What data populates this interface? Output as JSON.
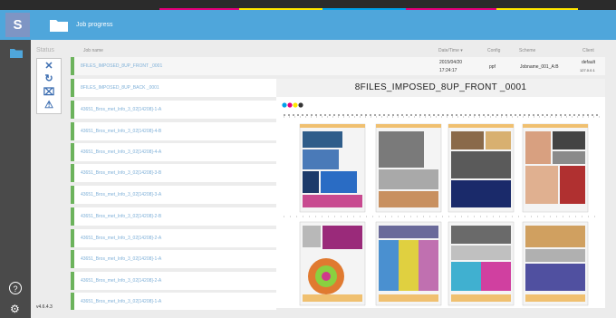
{
  "app": {
    "logo_letter": "S",
    "title": "Job progress"
  },
  "sidebar": {
    "folder_icon": "folder-icon",
    "help_icon": "help-icon",
    "settings_icon": "gear-icon"
  },
  "status_header": "Status",
  "actions": [
    {
      "name": "cancel-action",
      "icon": "close-icon",
      "glyph": "✕"
    },
    {
      "name": "refresh-action",
      "icon": "refresh-icon",
      "glyph": "↻"
    },
    {
      "name": "delete-action",
      "icon": "trash-icon",
      "glyph": "⌧"
    },
    {
      "name": "warning-action",
      "icon": "warning-icon",
      "glyph": "⚠"
    }
  ],
  "table": {
    "headers": {
      "job_name": "Job name",
      "datetime": "Date/Time ▾",
      "config": "Config",
      "scheme": "Scheme",
      "client": "Client"
    },
    "selected": {
      "job_name": "8FILES_IMPOSED_8UP_FRONT _0001",
      "date": "2015/04/20",
      "time": "17:24:17",
      "config": "ppf",
      "scheme": "Jobname_001_A:B",
      "client_name": "default",
      "client_ip": "127.0.0.1"
    },
    "rows": [
      "8FILES_IMPOSED_8UP_BACK _0001",
      "43651_Bros_met_Info_3_02[14208]-1-A",
      "43651_Bros_met_Info_3_02[14208]-4-B",
      "43651_Bros_met_Info_3_02[14208]-4-A",
      "43651_Bros_met_Info_3_02[14208]-3-B",
      "43651_Bros_met_Info_3_02[14208]-3-A",
      "43651_Bros_met_Info_3_02[14208]-2-B",
      "43651_Bros_met_Info_3_02[14208]-2-A",
      "43651_Bros_met_Info_3_02[14208]-1-A",
      "43651_Bros_met_Info_3_02[14208]-2-A",
      "43651_Bros_met_Info_3_02[14208]-1-A"
    ]
  },
  "preview": {
    "title": "8FILES_IMPOSED_8UP_FRONT _0001"
  },
  "version": "v4.6.4.3",
  "colors": {
    "header_blue": "#4fa6db",
    "sidebar_dark": "#4a4a4a",
    "logo_purple": "#7e95c4",
    "row_accent_green": "#6cb35c",
    "row_text_blue": "#7fb0d8",
    "strip_colors": [
      "#e4007c",
      "#ffe600",
      "#00a0e9",
      "#e4007c",
      "#ffe600"
    ]
  }
}
